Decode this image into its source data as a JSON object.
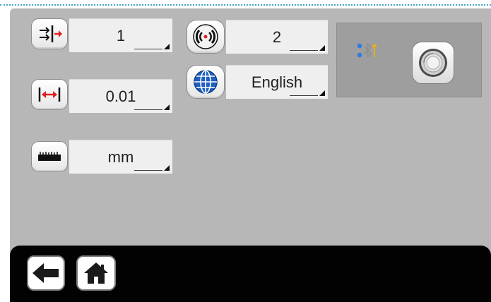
{
  "settings": {
    "step_direction": {
      "icon": "arrows-to-line-icon",
      "value": "1"
    },
    "resolution": {
      "icon": "double-arrow-width-icon",
      "value": "0.01"
    },
    "unit": {
      "icon": "ruler-icon",
      "value": "mm"
    },
    "signal": {
      "icon": "wireless-signal-icon",
      "value": "2"
    },
    "language": {
      "icon": "globe-icon",
      "value": "English"
    }
  },
  "bluetooth_panel": {
    "status_icon": "bluetooth-icon",
    "button_icon": "pairing-knob-icon",
    "colors": {
      "dot": "#2f7de1",
      "bt_symbol": "#f0b400"
    }
  },
  "nav": {
    "back_icon": "back-arrow-icon",
    "home_icon": "home-icon"
  },
  "colors": {
    "screen_bg": "#b7b7b7",
    "bar_bg": "#020202",
    "accent_red": "#e02020"
  }
}
